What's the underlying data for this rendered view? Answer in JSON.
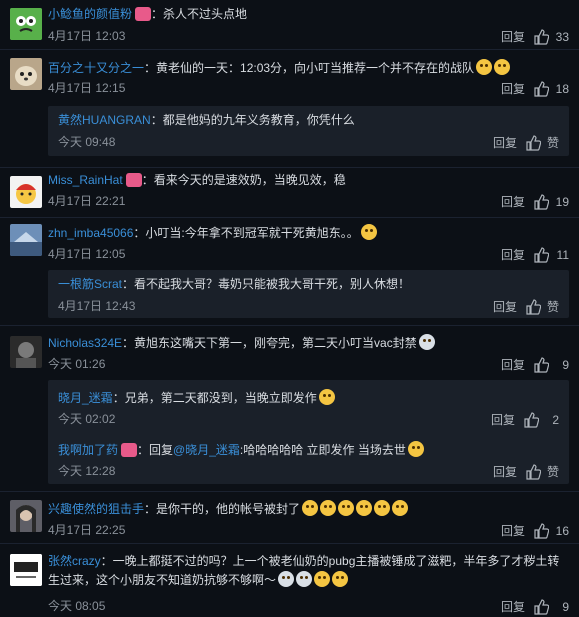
{
  "comments": [
    {
      "user": "小鲶鱼的颜值粉",
      "text": "：杀人不过头点地",
      "time": "4月17日 12:03",
      "reply_label": "回复",
      "likes": "33"
    },
    {
      "user": "百分之十又分之一",
      "text": "：黄老仙的一天：12:03分，向小叮当推荐一个并不存在的战队",
      "time": "4月17日 12:15",
      "reply_label": "回复",
      "likes": "18",
      "replies": [
        {
          "user": "黄然HUANGRAN",
          "text": "：都是他妈的九年义务教育，你凭什么",
          "time": "今天 09:48",
          "reply_label": "回复",
          "like_label": "赞"
        }
      ]
    },
    {
      "user": "Miss_RainHat",
      "text": "：看来今天的是速效奶，当晚见效，稳",
      "time": "4月17日 22:21",
      "reply_label": "回复",
      "likes": "19"
    },
    {
      "user": "zhn_imba45066",
      "text": "：小叮当:今年拿不到冠军就干死黄旭东。。",
      "time": "4月17日 12:05",
      "reply_label": "回复",
      "likes": "11",
      "replies": [
        {
          "user": "一根筋Scrat",
          "text": "：看不起我大哥？毒奶只能被我大哥干死，别人休想！",
          "time": "4月17日 12:43",
          "reply_label": "回复",
          "like_label": "赞"
        }
      ]
    },
    {
      "user": "Nicholas324E",
      "text": "：黄旭东这嘴天下第一，刚夸完，第二天小叮当vac封禁",
      "time": "今天 01:26",
      "reply_label": "回复",
      "likes": "9",
      "replies": [
        {
          "user": "晓月_迷霜",
          "text": "：兄弟，第二天都没到，当晚立即发作",
          "time": "今天 02:02",
          "reply_label": "回复",
          "like_count": "2"
        },
        {
          "user": "我啊加了药",
          "text": "：回复",
          "mention": "@晓月_迷霜",
          "text2": ":哈哈哈哈哈 立即发作 当场去世",
          "time": "今天 12:28",
          "reply_label": "回复",
          "like_label": "赞"
        }
      ]
    },
    {
      "user": "兴趣使然的狙击手",
      "text": "：是你干的，他的帐号被封了",
      "time": "4月17日 22:25",
      "reply_label": "回复",
      "likes": "16"
    },
    {
      "user": "张然crazy",
      "text": "：一晚上都挺不过的吗？上一个被老仙奶的pubg主播被锤成了滋粑，半年多了才秽土转生过来，这个小朋友不知道奶抗够不够啊～",
      "time": "今天 08:05",
      "reply_label": "回复",
      "likes": "9"
    }
  ],
  "colors": {
    "background": "#0c1016",
    "username": "#3a8fd8",
    "reply_box": "#1a2029"
  }
}
